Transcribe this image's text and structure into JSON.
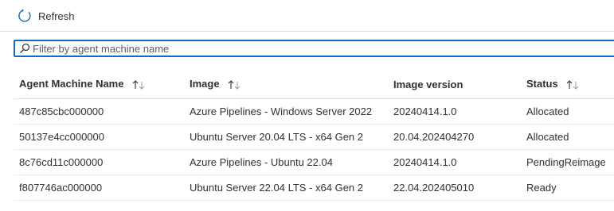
{
  "toolbar": {
    "refresh_label": "Refresh",
    "refresh_icon": "refresh-icon"
  },
  "filter": {
    "placeholder": "Filter by agent machine name",
    "value": "",
    "icon": "search-icon"
  },
  "table": {
    "columns": [
      {
        "label": "Agent Machine Name",
        "sortable": true
      },
      {
        "label": "Image",
        "sortable": true
      },
      {
        "label": "Image version",
        "sortable": false
      },
      {
        "label": "Status",
        "sortable": true
      }
    ],
    "rows": [
      {
        "name": "487c85cbc000000",
        "image": "Azure Pipelines - Windows Server 2022",
        "version": "20240414.1.0",
        "status": "Allocated"
      },
      {
        "name": "50137e4cc000000",
        "image": "Ubuntu Server 20.04 LTS - x64 Gen 2",
        "version": "20.04.202404270",
        "status": "Allocated"
      },
      {
        "name": "8c76cd11c000000",
        "image": "Azure Pipelines - Ubuntu 22.04",
        "version": "20240414.1.0",
        "status": "PendingReimage"
      },
      {
        "name": "f807746ac000000",
        "image": "Ubuntu Server 22.04 LTS - x64 Gen 2",
        "version": "22.04.202405010",
        "status": "Ready"
      }
    ]
  },
  "colors": {
    "accent": "#0f6cbd",
    "text": "#323130",
    "border": "#e1dfdd"
  }
}
